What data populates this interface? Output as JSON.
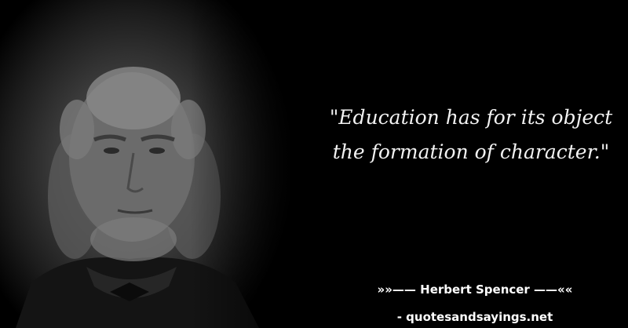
{
  "quote": {
    "line1": "\"Education has for its object",
    "line2": "the formation of character.\""
  },
  "attribution": {
    "author_line": "»»—— Herbert Spencer ——««",
    "source_line": "- quotesandsayings.net"
  },
  "colors": {
    "background": "#000000",
    "text": "#f2f2f2"
  }
}
